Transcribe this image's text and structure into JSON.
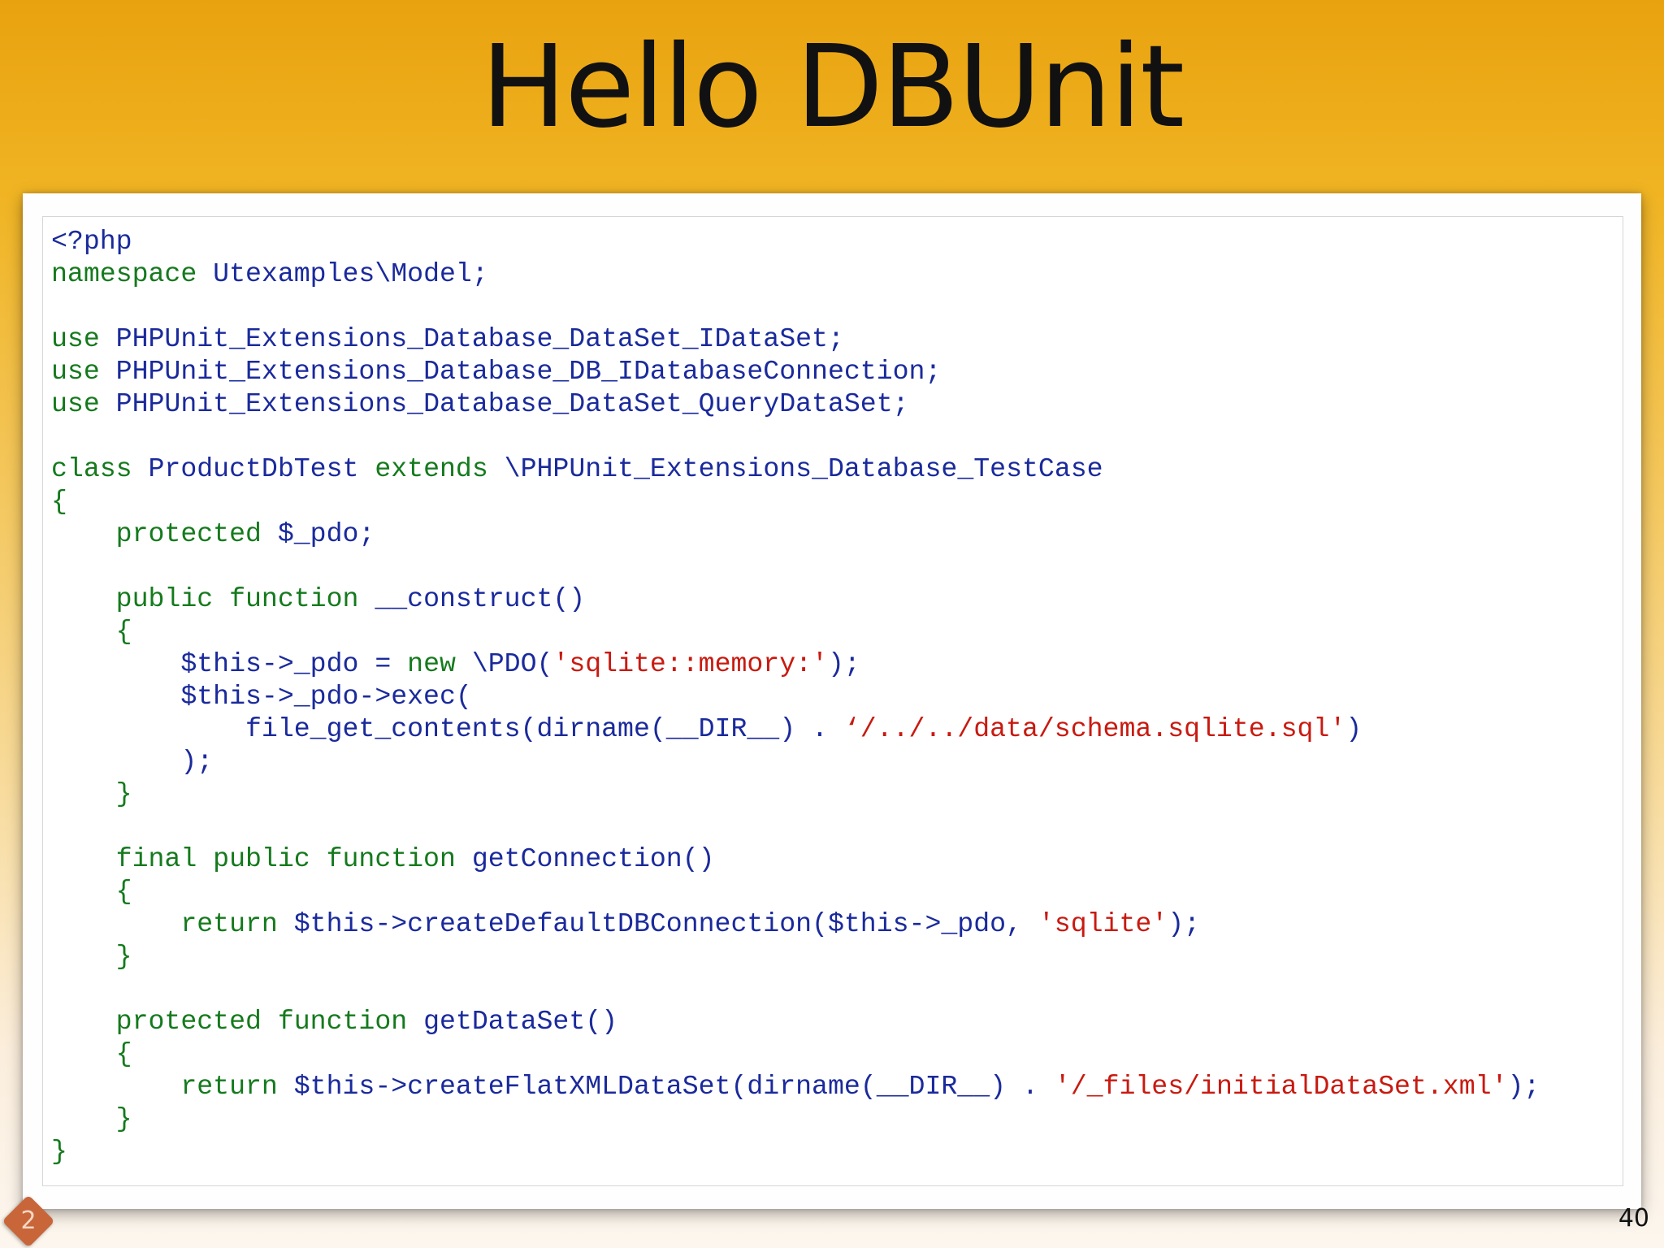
{
  "slide": {
    "title": "Hello DBUnit",
    "page_number": "40",
    "logo_text": "2"
  },
  "colors": {
    "keyword": "#157a1d",
    "identifier": "#1a2a9c",
    "string": "#c81a10",
    "background_top": "#e9a20f"
  },
  "code": {
    "lines": [
      [
        {
          "t": "<?php",
          "c": "id"
        }
      ],
      [
        {
          "t": "namespace",
          "c": "kw"
        },
        {
          "t": " Utexamples\\Model;",
          "c": "id"
        }
      ],
      [],
      [
        {
          "t": "use",
          "c": "kw"
        },
        {
          "t": " PHPUnit_Extensions_Database_DataSet_IDataSet;",
          "c": "id"
        }
      ],
      [
        {
          "t": "use",
          "c": "kw"
        },
        {
          "t": " PHPUnit_Extensions_Database_DB_IDatabaseConnection;",
          "c": "id"
        }
      ],
      [
        {
          "t": "use",
          "c": "kw"
        },
        {
          "t": " PHPUnit_Extensions_Database_DataSet_QueryDataSet;",
          "c": "id"
        }
      ],
      [],
      [
        {
          "t": "class",
          "c": "kw"
        },
        {
          "t": " ProductDbTest ",
          "c": "id"
        },
        {
          "t": "extends",
          "c": "kw"
        },
        {
          "t": " \\PHPUnit_Extensions_Database_TestCase",
          "c": "id"
        }
      ],
      [
        {
          "t": "{",
          "c": "kw"
        }
      ],
      [
        {
          "t": "    protected",
          "c": "kw"
        },
        {
          "t": " $_pdo;",
          "c": "id"
        }
      ],
      [],
      [
        {
          "t": "    public function",
          "c": "kw"
        },
        {
          "t": " __construct()",
          "c": "id"
        }
      ],
      [
        {
          "t": "    {",
          "c": "kw"
        }
      ],
      [
        {
          "t": "        $this->_pdo = ",
          "c": "id"
        },
        {
          "t": "new",
          "c": "kw"
        },
        {
          "t": " \\PDO(",
          "c": "id"
        },
        {
          "t": "'sqlite::memory:'",
          "c": "str"
        },
        {
          "t": ");",
          "c": "id"
        }
      ],
      [
        {
          "t": "        $this->_pdo->exec(",
          "c": "id"
        }
      ],
      [
        {
          "t": "            file_get_contents(dirname(__DIR__) . ",
          "c": "id"
        },
        {
          "t": "‘/../../data/schema.sqlite.sql'",
          "c": "str"
        },
        {
          "t": ")",
          "c": "id"
        }
      ],
      [
        {
          "t": "        );",
          "c": "id"
        }
      ],
      [
        {
          "t": "    }",
          "c": "kw"
        }
      ],
      [],
      [
        {
          "t": "    final public function",
          "c": "kw"
        },
        {
          "t": " getConnection()",
          "c": "id"
        }
      ],
      [
        {
          "t": "    {",
          "c": "kw"
        }
      ],
      [
        {
          "t": "        return",
          "c": "kw"
        },
        {
          "t": " $this->createDefaultDBConnection($this->_pdo, ",
          "c": "id"
        },
        {
          "t": "'sqlite'",
          "c": "str"
        },
        {
          "t": ");",
          "c": "id"
        }
      ],
      [
        {
          "t": "    }",
          "c": "kw"
        }
      ],
      [],
      [
        {
          "t": "    protected function",
          "c": "kw"
        },
        {
          "t": " getDataSet()",
          "c": "id"
        }
      ],
      [
        {
          "t": "    {",
          "c": "kw"
        }
      ],
      [
        {
          "t": "        return",
          "c": "kw"
        },
        {
          "t": " $this->createFlatXMLDataSet(dirname(__DIR__) . ",
          "c": "id"
        },
        {
          "t": "'/_files/initialDataSet.xml'",
          "c": "str"
        },
        {
          "t": ");",
          "c": "id"
        }
      ],
      [
        {
          "t": "    }",
          "c": "kw"
        }
      ],
      [
        {
          "t": "}",
          "c": "kw"
        }
      ]
    ]
  }
}
